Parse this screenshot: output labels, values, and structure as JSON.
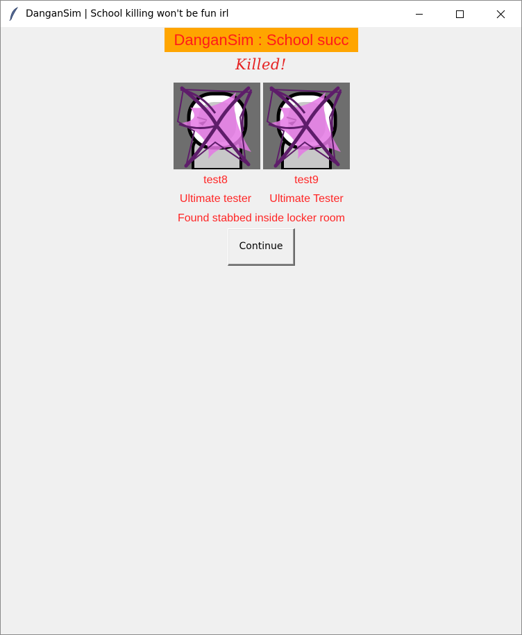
{
  "window": {
    "title": "DanganSim | School killing won't be fun irl",
    "app_icon": "feather-icon",
    "controls": [
      "minimize-icon",
      "maximize-icon",
      "close-icon"
    ]
  },
  "header": {
    "title": "DanganSim : School succ",
    "background_color": "#ffa500",
    "text_color": "#ff1a1a"
  },
  "status": {
    "label": "Killed!"
  },
  "victims": [
    {
      "name": "test8",
      "talent": "Ultimate tester",
      "portrait_icon": "crossed-out-character-portrait"
    },
    {
      "name": "test9",
      "talent": "Ultimate Tester",
      "portrait_icon": "crossed-out-character-portrait"
    }
  ],
  "death_cause": "Found stabbed inside locker room",
  "actions": {
    "continue_label": "Continue"
  },
  "colors": {
    "text_red": "#ff2525",
    "portrait_bg": "#6e6e6e",
    "cross_mark": "#6a1f6a",
    "window_bg": "#f0f0f0"
  }
}
